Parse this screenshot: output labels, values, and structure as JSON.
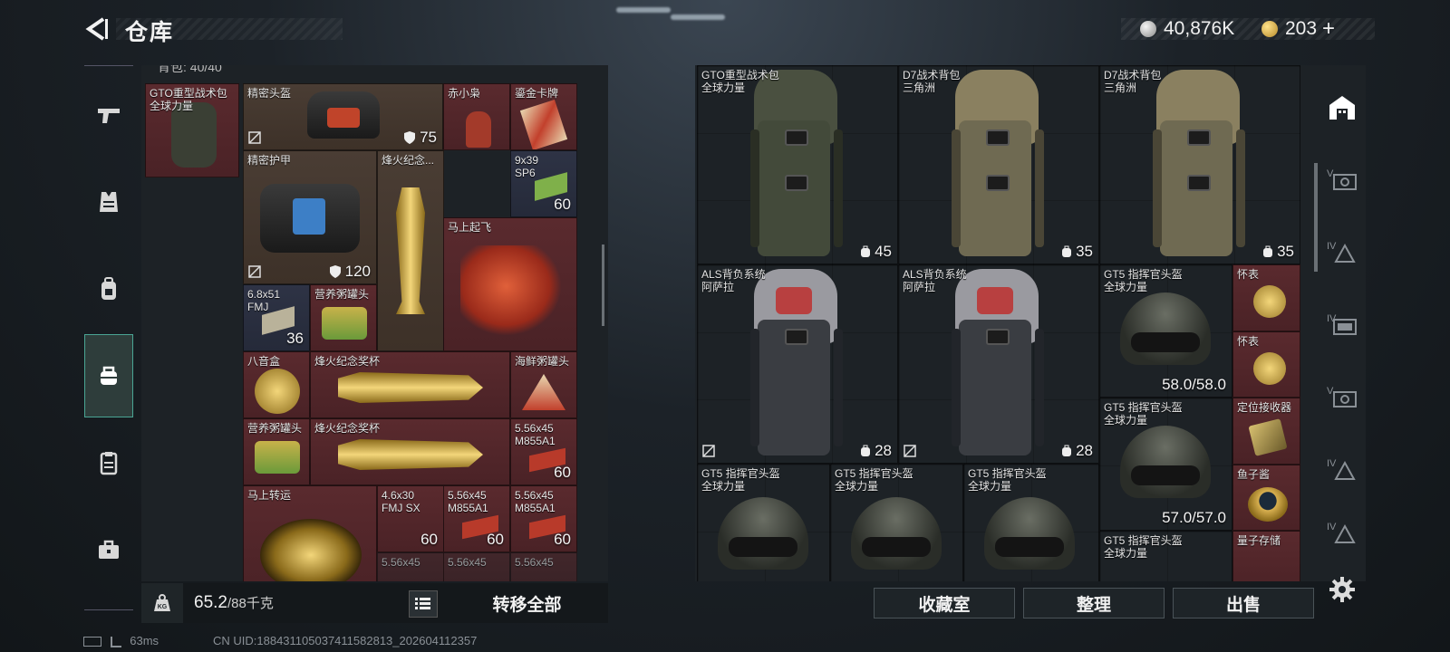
{
  "header": {
    "title": "仓库",
    "back_icon": "back-arrow-icon"
  },
  "currency": {
    "silver": {
      "value": "40,876K",
      "icon": "silver-coin-icon"
    },
    "gold": {
      "value": "203",
      "icon": "gold-coin-icon",
      "add": "+"
    }
  },
  "left_nav": [
    {
      "name": "nav-weapons",
      "icon": "pistol-icon"
    },
    {
      "name": "nav-armor",
      "icon": "vest-icon"
    },
    {
      "name": "nav-backpack",
      "icon": "backpack-icon"
    },
    {
      "name": "nav-storage",
      "icon": "bag-icon",
      "active": true
    },
    {
      "name": "nav-clipboard",
      "icon": "clipboard-icon"
    },
    {
      "name": "nav-case",
      "icon": "briefcase-icon"
    }
  ],
  "left_panel": {
    "capacity_text": "背包: 40/40",
    "items": {
      "gto_bag": {
        "name": "GTO重型战术包\n全球力量"
      },
      "helmet": {
        "name": "精密头盔",
        "value": "75"
      },
      "chixiao": {
        "name": "赤小枭"
      },
      "card": {
        "name": "鎏金卡牌"
      },
      "armor": {
        "name": "精密护甲",
        "value": "120"
      },
      "trophy1": {
        "name": "烽火纪念..."
      },
      "ammo_939": {
        "name": "9x39\nSP6",
        "value": "60"
      },
      "horse": {
        "name": "马上起飞"
      },
      "ammo_68": {
        "name": "6.8x51\nFMJ",
        "value": "36"
      },
      "can1": {
        "name": "营养粥罐头"
      },
      "musicbox": {
        "name": "八音盒"
      },
      "trophy2": {
        "name": "烽火纪念奖杯"
      },
      "seafood": {
        "name": "海鲜粥罐头"
      },
      "can2": {
        "name": "营养粥罐头"
      },
      "trophy3": {
        "name": "烽火纪念奖杯"
      },
      "ammo_556a": {
        "name": "5.56x45\nM855A1",
        "value": "60"
      },
      "zhuanyun": {
        "name": "马上转运"
      },
      "ammo_46": {
        "name": "4.6x30\nFMJ SX",
        "value": "60"
      },
      "ammo_556b": {
        "name": "5.56x45\nM855A1",
        "value": "60"
      },
      "ammo_556c": {
        "name": "5.56x45\nM855A1",
        "value": "60"
      },
      "ammo_556d": {
        "name": "5.56x45"
      },
      "ammo_556e": {
        "name": "5.56x45"
      },
      "ammo_556f": {
        "name": "5.56x45"
      }
    }
  },
  "bottom_left": {
    "weight_current": "65.2",
    "weight_max": "/88千克",
    "transfer_all": "转移全部",
    "weight_icon": "kg-weight-icon",
    "list_icon": "list-icon"
  },
  "right_panel": {
    "items": {
      "r_gto": {
        "name": "GTO重型战术包\n全球力量",
        "value": "45"
      },
      "r_d7a": {
        "name": "D7战术背包\n三角洲",
        "value": "35"
      },
      "r_d7b": {
        "name": "D7战术背包\n三角洲",
        "value": "35"
      },
      "r_als1": {
        "name": "ALS背负系统\n阿萨拉",
        "value": "28"
      },
      "r_als2": {
        "name": "ALS背负系统\n阿萨拉",
        "value": "28"
      },
      "r_gt5a": {
        "name": "GT5 指挥官头盔\n全球力量",
        "value": "58.0/58.0"
      },
      "r_watch1": {
        "name": "怀表"
      },
      "r_watch2": {
        "name": "怀表"
      },
      "r_gt5b": {
        "name": "GT5 指挥官头盔\n全球力量",
        "value": "57.0/57.0"
      },
      "r_receiver": {
        "name": "定位接收器"
      },
      "r_caviar": {
        "name": "鱼子酱"
      },
      "r_gt5c": {
        "name": "GT5 指挥官头盔\n全球力量"
      },
      "r_gt5d": {
        "name": "GT5 指挥官头盔\n全球力量"
      },
      "r_gt5e": {
        "name": "GT5 指挥官头盔\n全球力量"
      },
      "r_gt5f": {
        "name": "GT5 指挥官头盔\n全球力量"
      },
      "r_quantum": {
        "name": "量子存储"
      }
    }
  },
  "actions": {
    "collection": "收藏室",
    "organize": "整理",
    "sell": "出售"
  },
  "right_nav": [
    {
      "name": "rnav-home",
      "icon": "storage-home-icon",
      "label": ""
    },
    {
      "name": "rnav-v1",
      "icon": "stash-v-icon",
      "label": "V"
    },
    {
      "name": "rnav-iv1",
      "icon": "stash-iv-icon",
      "label": "IV"
    },
    {
      "name": "rnav-iv2",
      "icon": "stash-iv-icon",
      "label": "IV"
    },
    {
      "name": "rnav-v2",
      "icon": "stash-v-icon",
      "label": "V"
    },
    {
      "name": "rnav-iv3",
      "icon": "stash-iv-icon",
      "label": "IV"
    },
    {
      "name": "rnav-iv4",
      "icon": "stash-iv-icon",
      "label": "IV"
    }
  ],
  "status": {
    "ping": "63ms",
    "uid": "CN UID:18843110503741158​2813_202604112357"
  },
  "colors": {
    "accent": "#4aa594",
    "slot_red": "#5a2a2e",
    "slot_brown": "#4a3d34",
    "slot_blue": "#2e3345"
  }
}
